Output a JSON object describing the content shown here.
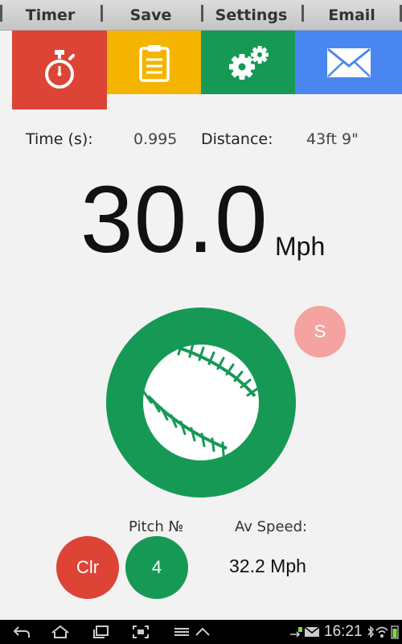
{
  "tabs": [
    {
      "label": "Timer"
    },
    {
      "label": "Save"
    },
    {
      "label": "Settings"
    },
    {
      "label": "Email"
    }
  ],
  "icons": {
    "timer": "stopwatch-icon",
    "save": "clipboard-icon",
    "settings": "gears-icon",
    "email": "envelope-icon"
  },
  "colors": {
    "red": "#dd4435",
    "yellow": "#f5b400",
    "green": "#169955",
    "blue": "#4a86f0",
    "pink": "#f4a3a0"
  },
  "stats": {
    "time_label": "Time (s):",
    "time_value": "0.995",
    "distance_label": "Distance:",
    "distance_value": "43ft 9\""
  },
  "speed": {
    "value": "30.0",
    "unit": "Mph"
  },
  "s_button": "S",
  "pitch": {
    "label": "Pitch №",
    "count": "4"
  },
  "average": {
    "label": "Av Speed:",
    "value": "32.2 Mph"
  },
  "clear_button": "Clr",
  "system_bar": {
    "time": "16:21"
  }
}
